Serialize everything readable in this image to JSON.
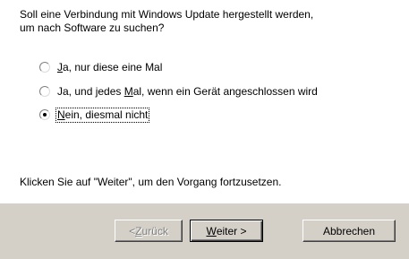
{
  "question": {
    "line1": "Soll eine Verbindung mit Windows Update hergestellt werden,",
    "line2": "um nach Software zu suchen?"
  },
  "options": [
    {
      "before": "",
      "accel": "J",
      "after": "a, nur diese eine Mal",
      "selected": false
    },
    {
      "before": "Ja, und jedes ",
      "accel": "M",
      "after": "al, wenn ein Gerät angeschlossen wird",
      "selected": false
    },
    {
      "before": "",
      "accel": "N",
      "after": "ein, diesmal nicht",
      "selected": true
    }
  ],
  "hint": "Klicken Sie auf \"Weiter\", um den Vorgang fortzusetzen.",
  "buttons": {
    "back": {
      "prefix": "< ",
      "accel": "Z",
      "suffix": "urück",
      "enabled": false
    },
    "next": {
      "prefix": "",
      "accel": "W",
      "suffix": "eiter >",
      "enabled": true
    },
    "cancel": {
      "label": "Abbrechen",
      "enabled": true
    }
  },
  "colors": {
    "dialog_background": "#ffffff",
    "button_face": "#d4d0c8",
    "disabled_text": "#808080"
  }
}
